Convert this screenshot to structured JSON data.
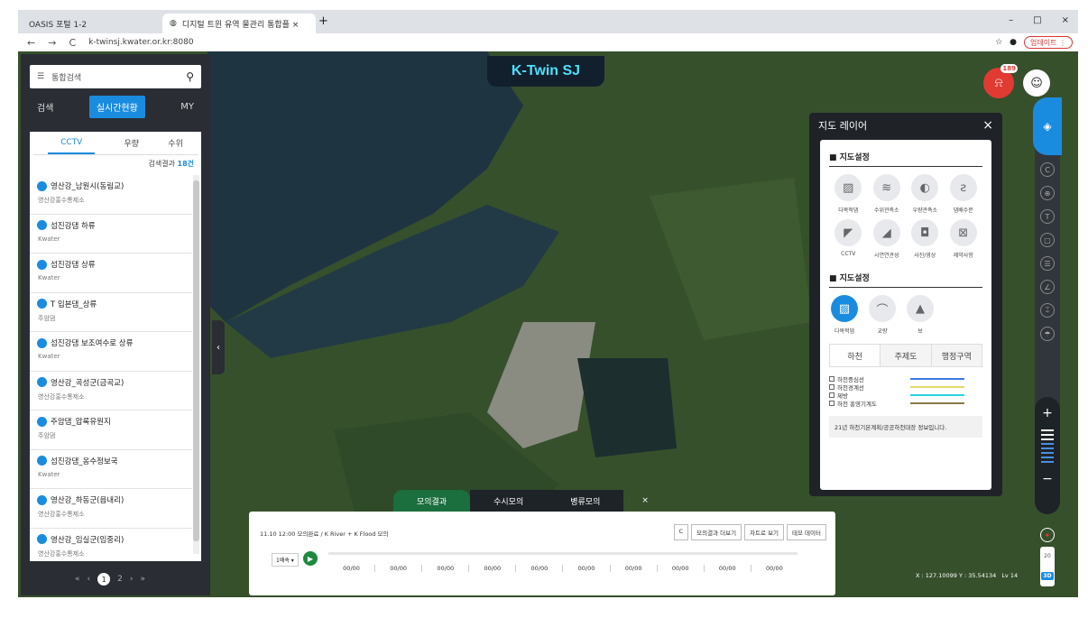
{
  "browser": {
    "tabs": [
      {
        "label": "OASIS 포털 1-2"
      },
      {
        "label": "디지털 트윈 유역 물관리 통합플 ×"
      }
    ],
    "close": "×",
    "new_tab": "+",
    "url": "k-twinsj.kwater.or.kr:8080",
    "update": "업데이트 ⋮",
    "win": [
      "–",
      "□",
      "×"
    ]
  },
  "header": {
    "logo": "K-Twin SJ",
    "alarm_badge": "189"
  },
  "search": {
    "placeholder": "통합검색"
  },
  "side_tabs": [
    "검색",
    "실시간현황",
    "MY"
  ],
  "panel": {
    "tabs": [
      "CCTV",
      "우량",
      "수위"
    ],
    "count_prefix": "검색결과 ",
    "count_value": "18건",
    "items": [
      {
        "title": "영산강_남원시(동림교)",
        "sub": "영산강홍수통제소"
      },
      {
        "title": "섬진강댐 하류",
        "sub": "Kwater"
      },
      {
        "title": "섬진강댐 상류",
        "sub": "Kwater"
      },
      {
        "title": "T 입본댐_상류",
        "sub": "주암댐"
      },
      {
        "title": "섬진강댐 보조여수로 상류",
        "sub": "Kwater"
      },
      {
        "title": "영산강_곡성군(금곡교)",
        "sub": "영산강홍수통제소"
      },
      {
        "title": "주암댐_압록유원지",
        "sub": "주암댐"
      },
      {
        "title": "섬진강댐_옹수정보국",
        "sub": "Kwater"
      },
      {
        "title": "영산강_하동군(읍내리)",
        "sub": "영산강홍수통제소"
      },
      {
        "title": "영산강_임실군(임중리)",
        "sub": "영산강홍수통제소"
      }
    ]
  },
  "pager": {
    "prev2": "«",
    "prev": "‹",
    "current": "1",
    "next_page": "2",
    "next": "›",
    "next2": "»"
  },
  "layer": {
    "title": "지도 레이어",
    "close": "×",
    "sec1": "■ 지도설정",
    "icons1": [
      {
        "label": "다목적댐",
        "icon": "dam-icon"
      },
      {
        "label": "수위관측소",
        "icon": "water-level-icon"
      },
      {
        "label": "우량관측소",
        "icon": "rain-icon"
      },
      {
        "label": "댐배수문",
        "icon": "gate-icon"
      },
      {
        "label": "CCTV",
        "icon": "cctv-icon"
      },
      {
        "label": "시연연관성",
        "icon": "link-icon"
      },
      {
        "label": "사진/영상",
        "icon": "camera-icon"
      },
      {
        "label": "제약사항",
        "icon": "restrict-icon"
      }
    ],
    "sec2": "■ 지도설정",
    "icons2": [
      {
        "label": "다목적댐",
        "icon": "dam-icon",
        "active": true
      },
      {
        "label": "교량",
        "icon": "bridge-icon"
      },
      {
        "label": "보",
        "icon": "weir-icon"
      }
    ],
    "tabs": [
      "하천",
      "주제도",
      "행정구역"
    ],
    "legend": [
      {
        "label": "하천중심선",
        "color": "#3a7be0"
      },
      {
        "label": "하천경계선",
        "color": "#e8d86a"
      },
      {
        "label": "제방",
        "color": "#2ad3e8"
      },
      {
        "label": "하천 홍영기계도",
        "color": "#8a7a4a"
      }
    ],
    "note": "21년 하천기본계획/공공하천대장 정보입니다."
  },
  "tools": [
    "C",
    "⊕",
    "T",
    "▢",
    "☰",
    "∠",
    "⌶",
    "☂"
  ],
  "zoom": {
    "plus": "+",
    "minus": "−"
  },
  "scale": {
    "a": "20",
    "b": "3D"
  },
  "coord": {
    "text": "X : 127.10099 Y : 35.54134",
    "level": "Lv 14"
  },
  "bottom": {
    "tabs": [
      "모의결과",
      "수시모의",
      "병류모의"
    ],
    "close": "×",
    "info": "11.10 12:00 모의완료 / K River + K Flood 모의",
    "buttons": [
      "C",
      "모의결과 더보기",
      "차트로 보기",
      "테모 데이터"
    ],
    "speed": "1배속 ▾",
    "times": [
      "00/00",
      "00/00",
      "00/00",
      "00/00",
      "00/00",
      "00/00",
      "00/00",
      "00/00",
      "00/00",
      "00/00"
    ]
  }
}
